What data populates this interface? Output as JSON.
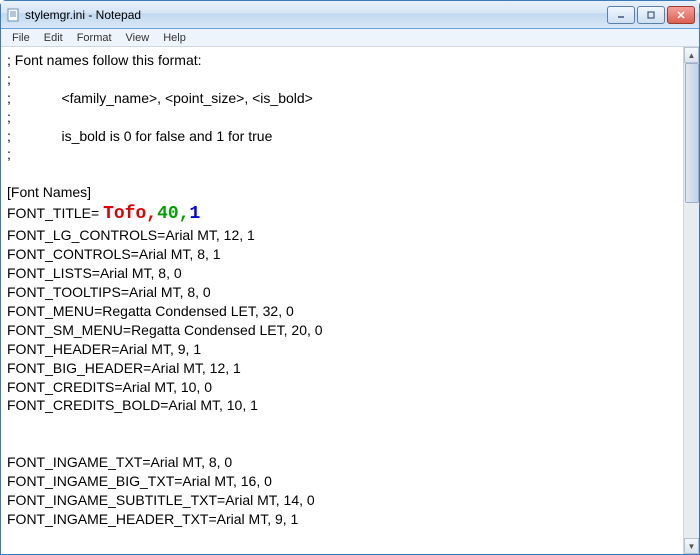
{
  "window": {
    "title": "stylemgr.ini - Notepad"
  },
  "menu": {
    "file": "File",
    "edit": "Edit",
    "format": "Format",
    "view": "View",
    "help": "Help"
  },
  "doc": {
    "l1": "; Font names follow this format:",
    "l2": ";",
    "l3": ";             <family_name>, <point_size>, <is_bold>",
    "l4": ";",
    "l5": ";             is_bold is 0 for false and 1 for true",
    "l6": ";",
    "l7": "",
    "l8": "[Font Names]",
    "l9a": "FONT_TITLE= ",
    "l9b": "Tofo,",
    "l9c": "40,",
    "l9d": "1",
    "l10": "FONT_LG_CONTROLS=Arial MT, 12, 1",
    "l11": "FONT_CONTROLS=Arial MT, 8, 1",
    "l12": "FONT_LISTS=Arial MT, 8, 0",
    "l13": "FONT_TOOLTIPS=Arial MT, 8, 0",
    "l14": "FONT_MENU=Regatta Condensed LET, 32, 0",
    "l15": "FONT_SM_MENU=Regatta Condensed LET, 20, 0",
    "l16": "FONT_HEADER=Arial MT, 9, 1",
    "l17": "FONT_BIG_HEADER=Arial MT, 12, 1",
    "l18": "FONT_CREDITS=Arial MT, 10, 0",
    "l19": "FONT_CREDITS_BOLD=Arial MT, 10, 1",
    "l20": "",
    "l21": "",
    "l22": "FONT_INGAME_TXT=Arial MT, 8, 0",
    "l23": "FONT_INGAME_BIG_TXT=Arial MT, 16, 0",
    "l24": "FONT_INGAME_SUBTITLE_TXT=Arial MT, 14, 0",
    "l25": "FONT_INGAME_HEADER_TXT=Arial MT, 9, 1"
  }
}
